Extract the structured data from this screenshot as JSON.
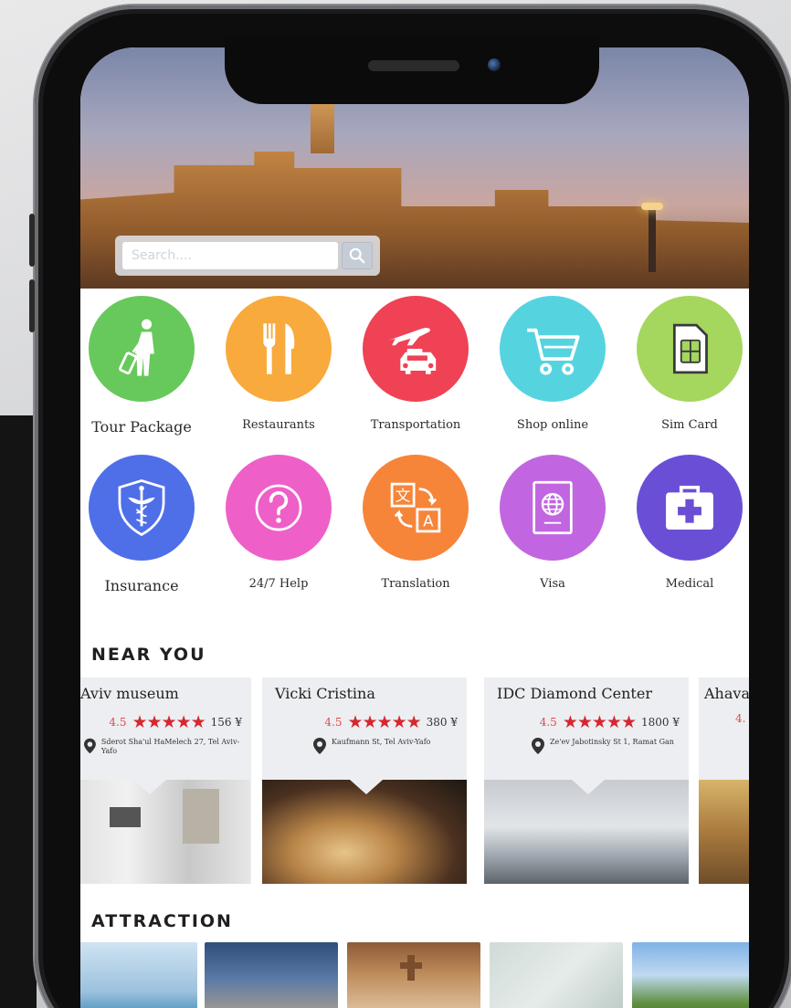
{
  "search": {
    "placeholder": "Search...."
  },
  "categories": [
    {
      "label": "Tour Package",
      "icon": "walking-luggage-icon",
      "color": "#67c95b"
    },
    {
      "label": "Restaurants",
      "icon": "fork-knife-icon",
      "color": "#f8aa3c"
    },
    {
      "label": "Transportation",
      "icon": "plane-taxi-icon",
      "color": "#ef4254"
    },
    {
      "label": "Shop online",
      "icon": "shopping-cart-icon",
      "color": "#55d4e0"
    },
    {
      "label": "Sim Card",
      "icon": "sim-card-icon",
      "color": "#a5d65e"
    },
    {
      "label": "Insurance",
      "icon": "caduceus-shield-icon",
      "color": "#4f6fe8"
    },
    {
      "label": "24/7 Help",
      "icon": "question-mark-icon",
      "color": "#ef5fc8"
    },
    {
      "label": "Translation",
      "icon": "translate-icon",
      "color": "#f6853a"
    },
    {
      "label": "Visa",
      "icon": "passport-icon",
      "color": "#c166e0"
    },
    {
      "label": "Medical",
      "icon": "first-aid-kit-icon",
      "color": "#6a4fd6"
    }
  ],
  "near_you": {
    "title": "NEAR YOU",
    "cards": [
      {
        "name": "Aviv museum",
        "score": "4.5",
        "stars": "★★★★★",
        "price": "156 ¥",
        "address": "Sderot Sha'ul HaMelech 27, Tel Aviv-Yafo"
      },
      {
        "name": "Vicki Cristina",
        "score": "4.5",
        "stars": "★★★★★",
        "price": "380 ¥",
        "address": "Kaufmann St, Tel Aviv-Yafo"
      },
      {
        "name": "IDC Diamond Center",
        "score": "4.5",
        "stars": "★★★★★",
        "price": "1800 ¥",
        "address": "Ze'ev Jabotinsky St 1, Ramat Gan"
      },
      {
        "name": "Ahava",
        "score": "4."
      }
    ]
  },
  "attraction": {
    "title": "ATTRACTION"
  }
}
